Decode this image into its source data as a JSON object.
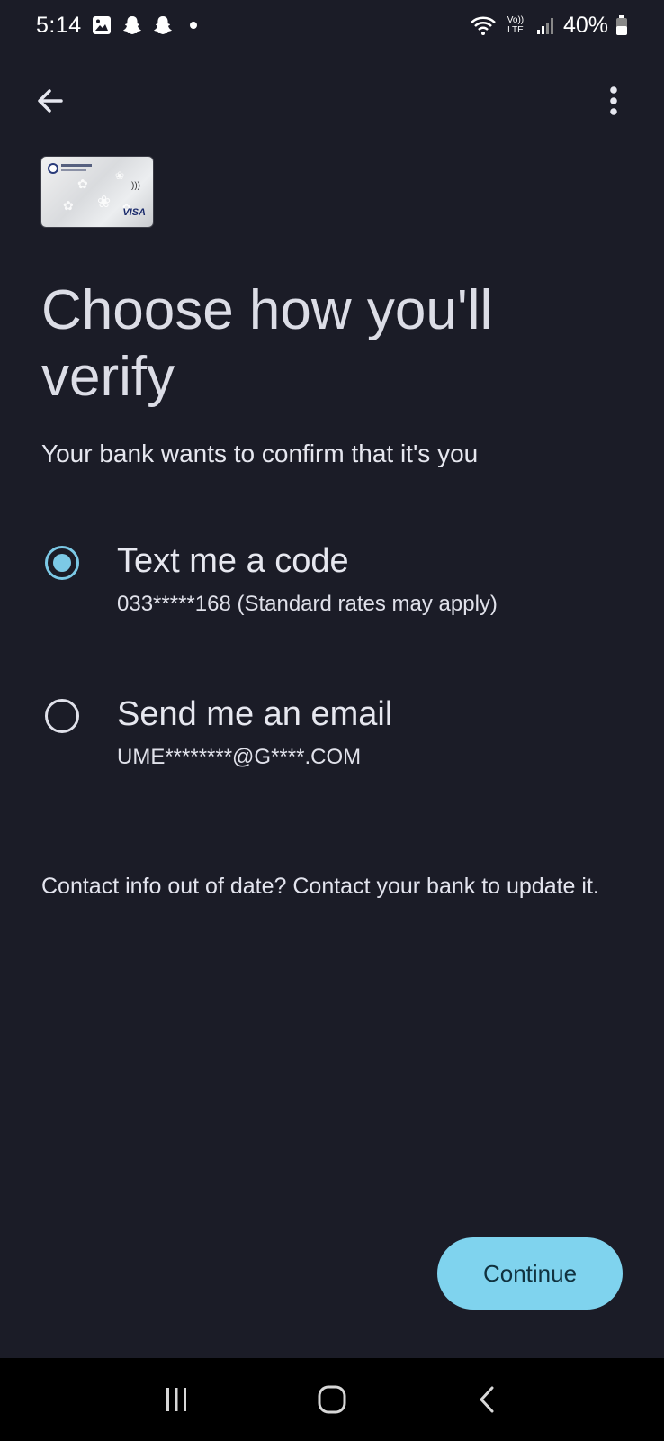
{
  "status_bar": {
    "time": "5:14",
    "battery": "40%",
    "icons": [
      "gallery-icon",
      "snapchat-icon",
      "snapchat-icon",
      "dot-icon",
      "wifi-icon",
      "volte-icon",
      "signal-icon",
      "battery-icon"
    ],
    "network_label_top": "Vo))",
    "network_label_bottom": "LTE"
  },
  "app_bar": {
    "back_icon": "arrow-left-icon",
    "menu_icon": "more-vertical-icon"
  },
  "card": {
    "brand": "VISA"
  },
  "header": {
    "title": "Choose how you'll verify",
    "subtitle": "Your bank wants to confirm that it's you"
  },
  "options": [
    {
      "label": "Text me a code",
      "detail": "033*****168 (Standard rates may apply)",
      "selected": true
    },
    {
      "label": "Send me an email",
      "detail": "UME********@G****.COM",
      "selected": false
    }
  ],
  "note": "Contact info out of date? Contact your bank to update it.",
  "actions": {
    "continue_label": "Continue"
  },
  "colors": {
    "background": "#1b1c27",
    "accent": "#7fd3ee",
    "button_text": "#10323f"
  }
}
